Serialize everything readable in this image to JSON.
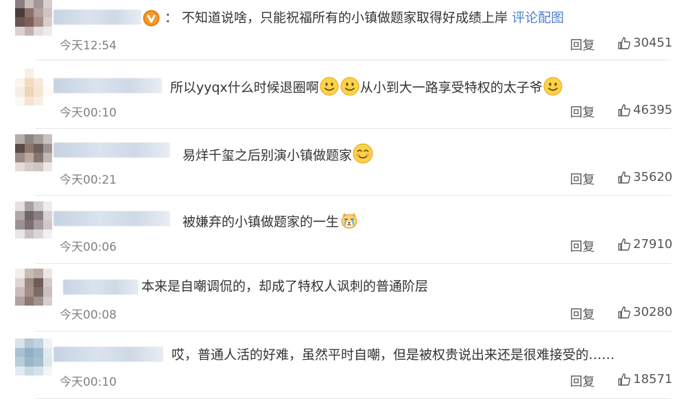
{
  "colors": {
    "link": "#5080c8",
    "time": "#808080",
    "divider": "#e6e6e6",
    "verified_badge": "#e8831a"
  },
  "comments": [
    {
      "verified": true,
      "text": "：  不知道说啥，只能祝福所有的小镇做题家取得好成绩上岸",
      "link": "评论配图",
      "time": "今天12:54",
      "reply_label": "回复",
      "likes": "30451"
    },
    {
      "text_parts": [
        "所以yyqx什么时候退圈啊",
        "从小到大一路享受特权的太子爷"
      ],
      "emoji": "smile-emoji",
      "time": "今天00:10",
      "reply_label": "回复",
      "likes": "46395"
    },
    {
      "text": "易烊千玺之后别演小镇做题家",
      "emoji": "blush-emoji",
      "time": "今天00:21",
      "reply_label": "回复",
      "likes": "35620"
    },
    {
      "text": "被嫌弃的小镇做题家的一生",
      "emoji": "crying-dog-emoji",
      "time": "今天00:06",
      "reply_label": "回复",
      "likes": "27910"
    },
    {
      "text": "本来是自嘲调侃的，却成了特权人讽刺的普通阶层",
      "time": "今天00:08",
      "reply_label": "回复",
      "likes": "30280"
    },
    {
      "text": "哎，普通人活的好难，虽然平时自嘲，但是被权贵说出来还是很难接受的……",
      "time": "今天00:10",
      "reply_label": "回复",
      "likes": "18571"
    }
  ]
}
